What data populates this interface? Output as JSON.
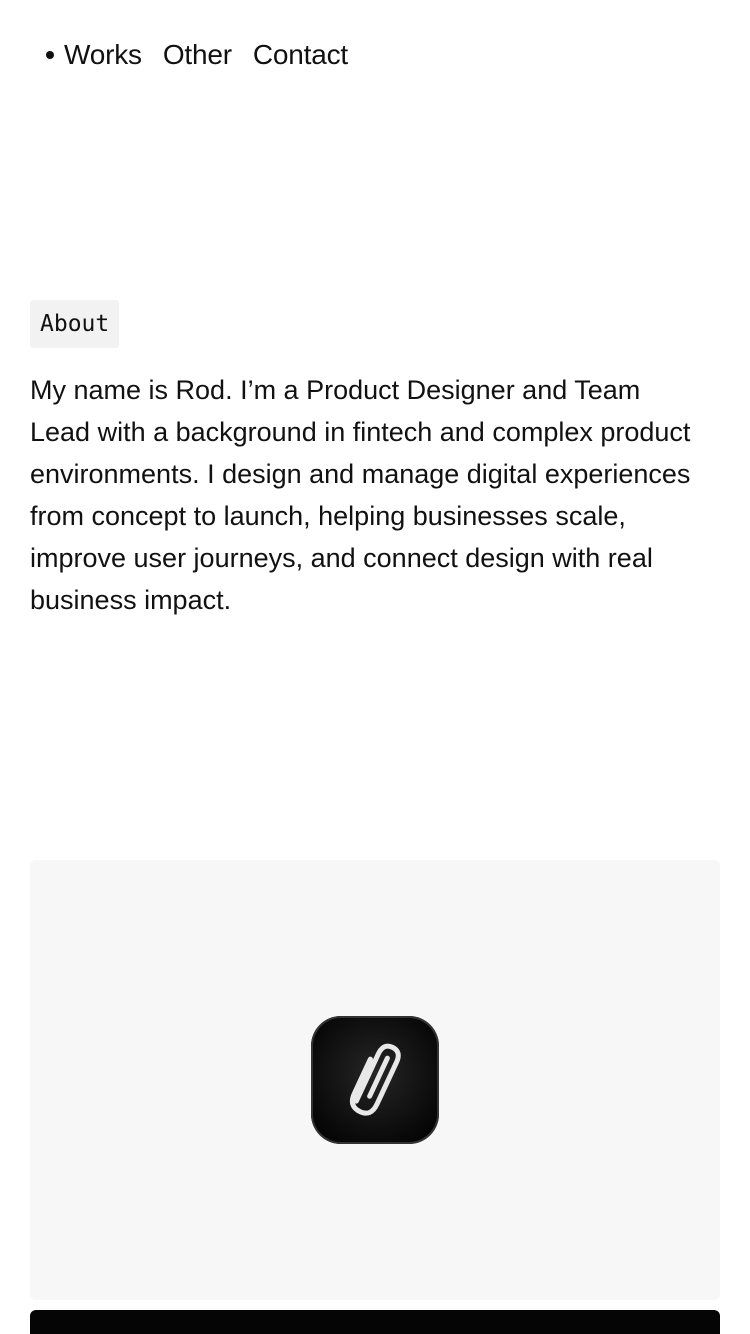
{
  "nav": {
    "items": [
      {
        "label": "Works",
        "active": true
      },
      {
        "label": "Other",
        "active": false
      },
      {
        "label": "Contact",
        "active": false
      }
    ]
  },
  "about": {
    "tag": "About",
    "text": "My name is Rod. I’m a Product Designer and Team Lead with a background in fintech and complex product environments. I design and manage digital experiences from concept to launch, helping businesses scale, improve user journeys, and connect design with real business impact."
  },
  "project_card": {
    "icon": "paperclip-icon",
    "background": "#f7f7f7",
    "icon_background": "#000000"
  },
  "next_card": {
    "background": "#050505"
  }
}
